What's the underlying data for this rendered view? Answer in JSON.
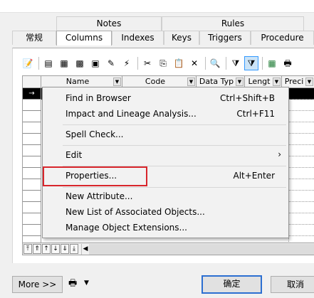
{
  "tabs_row1": [
    {
      "label": "Notes"
    },
    {
      "label": "Rules"
    }
  ],
  "tabs_row2": [
    {
      "label": "常规"
    },
    {
      "label": "Columns"
    },
    {
      "label": "Indexes"
    },
    {
      "label": "Keys"
    },
    {
      "label": "Triggers"
    },
    {
      "label": "Procedure"
    }
  ],
  "active_tab": "Columns",
  "toolbar_icons": [
    "properties-icon",
    "insert-row-icon",
    "add-row-icon",
    "add-columns-icon",
    "reuse-columns-icon",
    "clear-filter-icon",
    "cut-icon",
    "copy-icon",
    "paste-icon",
    "delete-icon",
    "find-icon",
    "filter-icon",
    "filter-active-icon",
    "excel-export-icon",
    "print-icon"
  ],
  "grid": {
    "columns": [
      {
        "label": "Name"
      },
      {
        "label": "Code"
      },
      {
        "label": "Data Typ"
      },
      {
        "label": "Lengt"
      },
      {
        "label": "Preci"
      }
    ],
    "row_count": 14
  },
  "context_menu": {
    "items": [
      {
        "label": "Find in Browser",
        "shortcut": "Ctrl+Shift+B"
      },
      {
        "label": "Impact and Lineage Analysis...",
        "shortcut": "Ctrl+F11"
      },
      {
        "label": "Spell Check...",
        "shortcut": ""
      },
      {
        "label": "Edit",
        "shortcut": ""
      },
      {
        "label": "Properties...",
        "shortcut": "Alt+Enter"
      },
      {
        "label": "New Attribute...",
        "shortcut": ""
      },
      {
        "label": "New List of Associated Objects...",
        "shortcut": ""
      },
      {
        "label": "Manage Object Extensions...",
        "shortcut": ""
      }
    ],
    "highlighted_item": "Properties...",
    "highlight_color": "#d8262c"
  },
  "buttons": {
    "more": "More >>",
    "ok": "确定",
    "cancel": "取消"
  },
  "colors": {
    "selected_row": "#000000",
    "default_button_border": "#2c6fd1"
  }
}
